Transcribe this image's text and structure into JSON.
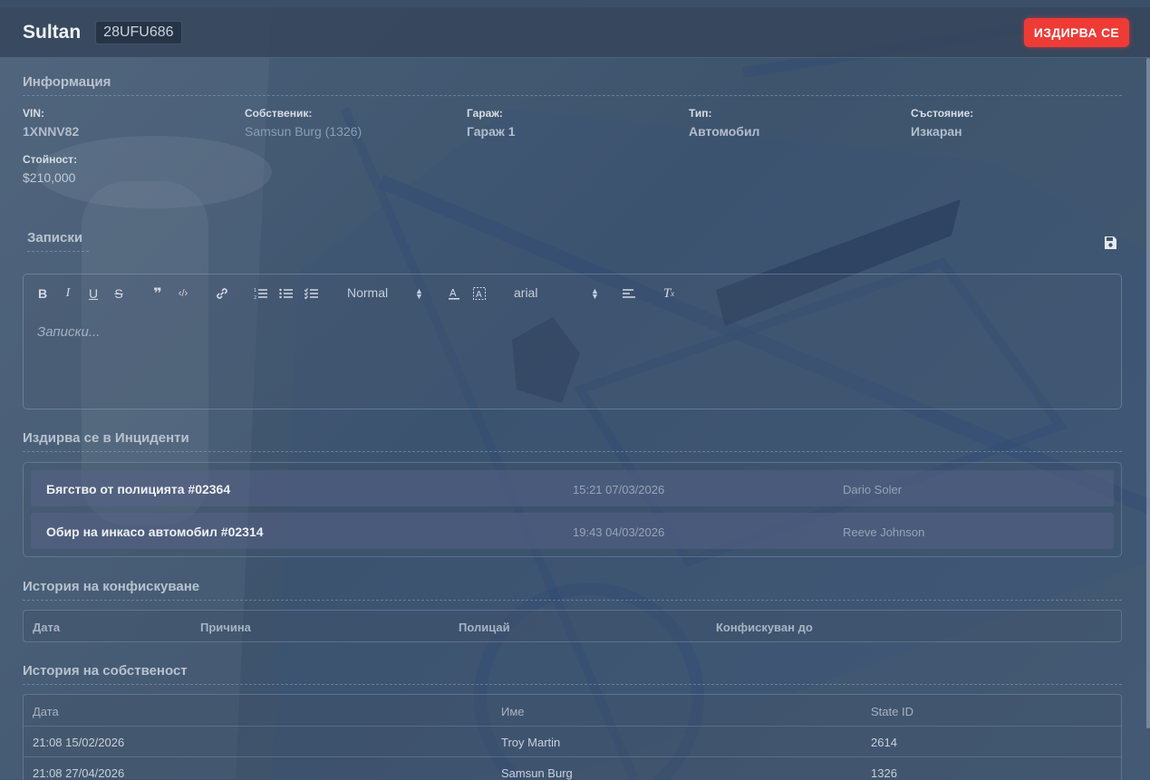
{
  "header": {
    "vehicle_name": "Sultan",
    "plate": "28UFU686",
    "status_button": "ИЗДИРВА СЕ"
  },
  "info": {
    "title": "Информация",
    "fields": [
      {
        "label": "VIN:",
        "value": "1XNNV82"
      },
      {
        "label": "Собственик:",
        "value": "Samsun Burg (1326)"
      },
      {
        "label": "Гараж:",
        "value": "Гараж 1"
      },
      {
        "label": "Тип:",
        "value": "Автомобил"
      },
      {
        "label": "Състояние:",
        "value": "Изкаран"
      },
      {
        "label": "Стойност:",
        "value": "$210,000"
      }
    ]
  },
  "notes": {
    "title": "Записки",
    "placeholder": "Записки...",
    "header_select": "Normal",
    "font_select": "arial"
  },
  "incidents": {
    "title": "Издирва се в Инциденти",
    "rows": [
      {
        "title": "Бягство от полицията #02364",
        "time": "15:21 07/03/2026",
        "officer": "Dario Soler"
      },
      {
        "title": "Обир на инкасо автомобил #02314",
        "time": "19:43 04/03/2026",
        "officer": "Reeve Johnson"
      }
    ]
  },
  "impound": {
    "title": "История на конфискуване",
    "columns": [
      "Дата",
      "Причина",
      "Полицай",
      "Конфискуван до"
    ]
  },
  "ownership": {
    "title": "История на собственост",
    "columns": [
      "Дата",
      "Име",
      "State ID"
    ],
    "rows": [
      [
        "21:08 15/02/2026",
        "Troy Martin",
        "2614"
      ],
      [
        "21:08 27/04/2026",
        "Samsun Burg",
        "1326"
      ]
    ]
  },
  "colors": {
    "accent_danger": "#ef3b36",
    "panel_bg": "#3f546c"
  }
}
